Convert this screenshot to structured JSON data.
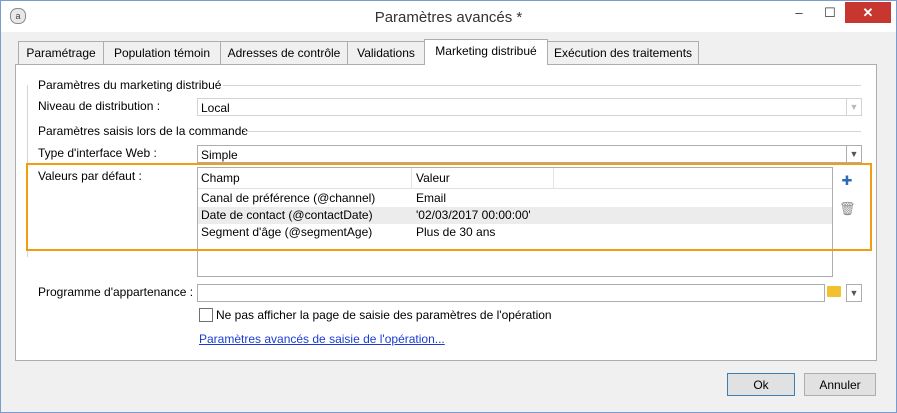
{
  "window": {
    "title": "Paramètres avancés *",
    "app_icon": "ac-logo-icon",
    "min": "–",
    "max": "☐",
    "close": "✕"
  },
  "tabs": [
    {
      "label": "Paramétrage",
      "active": false
    },
    {
      "label": "Population témoin",
      "active": false
    },
    {
      "label": "Adresses de contrôle",
      "active": false
    },
    {
      "label": "Validations",
      "active": false
    },
    {
      "label": "Marketing distribué",
      "active": true
    },
    {
      "label": "Exécution des traitements",
      "active": false
    }
  ],
  "section1": {
    "title": "Paramètres du marketing distribué"
  },
  "distribution": {
    "label": "Niveau de distribution :",
    "value": "Local"
  },
  "section2": {
    "title": "Paramètres saisis lors de la commande"
  },
  "web_interface": {
    "label": "Type d'interface Web :",
    "value": "Simple"
  },
  "defaults": {
    "label": "Valeurs par défaut :",
    "columns": [
      "Champ",
      "Valeur"
    ],
    "rows": [
      {
        "field": "Canal de préférence (@channel)",
        "value": "Email"
      },
      {
        "field": "Date de contact (@contactDate)",
        "value": "'02/03/2017 00:00:00'"
      },
      {
        "field": "Segment d'âge (@segmentAge)",
        "value": "Plus de 30 ans"
      }
    ],
    "highlight_color": "#f39c12"
  },
  "program": {
    "label": "Programme d'appartenance :",
    "value": ""
  },
  "hide_page_checkbox": {
    "label": "Ne pas afficher la page de saisie des paramètres de l'opération",
    "checked": false
  },
  "advanced_link": {
    "label": "Paramètres avancés de saisie de l'opération..."
  },
  "buttons": {
    "ok": "Ok",
    "cancel": "Annuler"
  },
  "colors": {
    "link": "#1a3bd4",
    "close_button": "#c7372f"
  }
}
